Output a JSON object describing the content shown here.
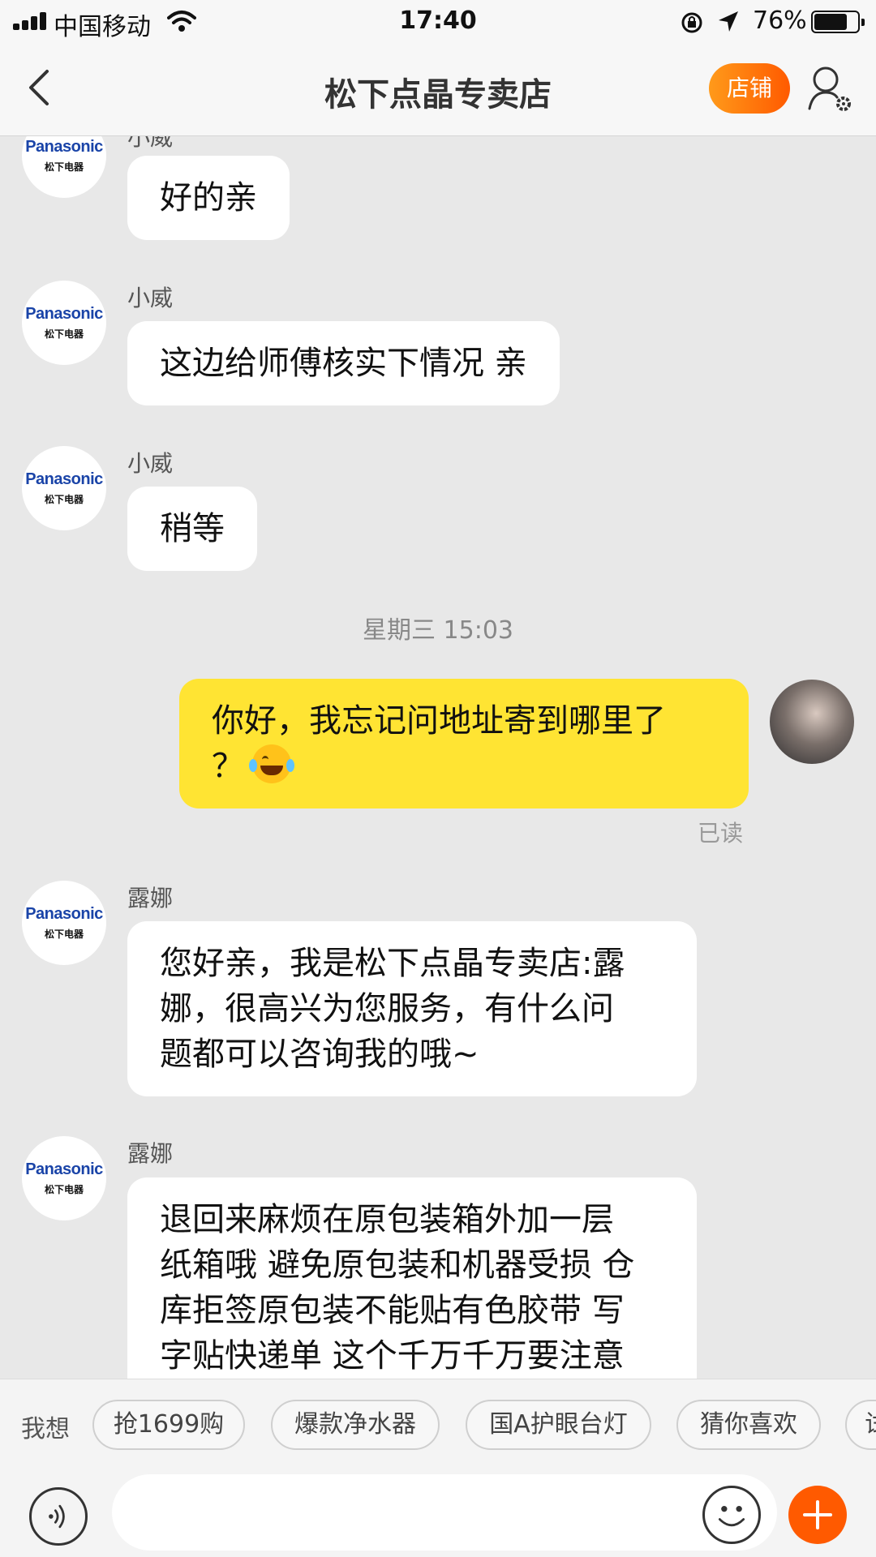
{
  "status_bar": {
    "carrier": "中国移动",
    "time": "17:40",
    "battery_percent": "76%",
    "battery_level": 0.76,
    "icons": [
      "signal-icon",
      "wifi-icon",
      "orientation-lock-icon",
      "location-arrow-icon",
      "battery-icon"
    ]
  },
  "nav": {
    "title": "松下点晶专卖店",
    "shop_label": "店铺",
    "icons": [
      "back-chevron-icon",
      "user-settings-icon"
    ]
  },
  "brand": {
    "logo_text": "Panasonic",
    "logo_sub": "松下电器"
  },
  "messages": [
    {
      "sender": "小威",
      "text": "好的亲",
      "side": "left"
    },
    {
      "sender": "小威",
      "text": "这边给师傅核实下情况 亲",
      "side": "left"
    },
    {
      "sender": "小威",
      "text": "稍等",
      "side": "left"
    },
    {
      "timestamp": "星期三 15:03"
    },
    {
      "sender": "",
      "text_lines": [
        "你好，我忘记问地址寄到哪里了",
        "？"
      ],
      "emoji": "tears-of-joy-emoji",
      "side": "right",
      "status": "已读"
    },
    {
      "sender": "露娜",
      "text_lines": [
        "您好亲，我是松下点晶专卖店:露",
        "娜，很高兴为您服务，有什么问",
        "题都可以咨询我的哦~"
      ],
      "side": "left"
    },
    {
      "sender": "露娜",
      "text_lines": [
        "退回来麻烦在原包装箱外加一层",
        "纸箱哦 避免原包装和机器受损 仓",
        "库拒签原包装不能贴有色胶带 写",
        "字贴快递单 这个千万千万要注意"
      ],
      "side": "left"
    }
  ],
  "quick_replies": {
    "label": "我想",
    "chips": [
      "抢1699购",
      "爆款净水器",
      "国A护眼台灯",
      "猜你喜欢",
      "试"
    ]
  },
  "input_bar": {
    "placeholder": "",
    "icons": [
      "voice-icon",
      "emoji-icon",
      "plus-icon"
    ]
  },
  "colors": {
    "accent": "#ff5a00",
    "my_bubble": "#ffe433",
    "background": "#e8e8e8",
    "brand_blue": "#1a44a8"
  }
}
